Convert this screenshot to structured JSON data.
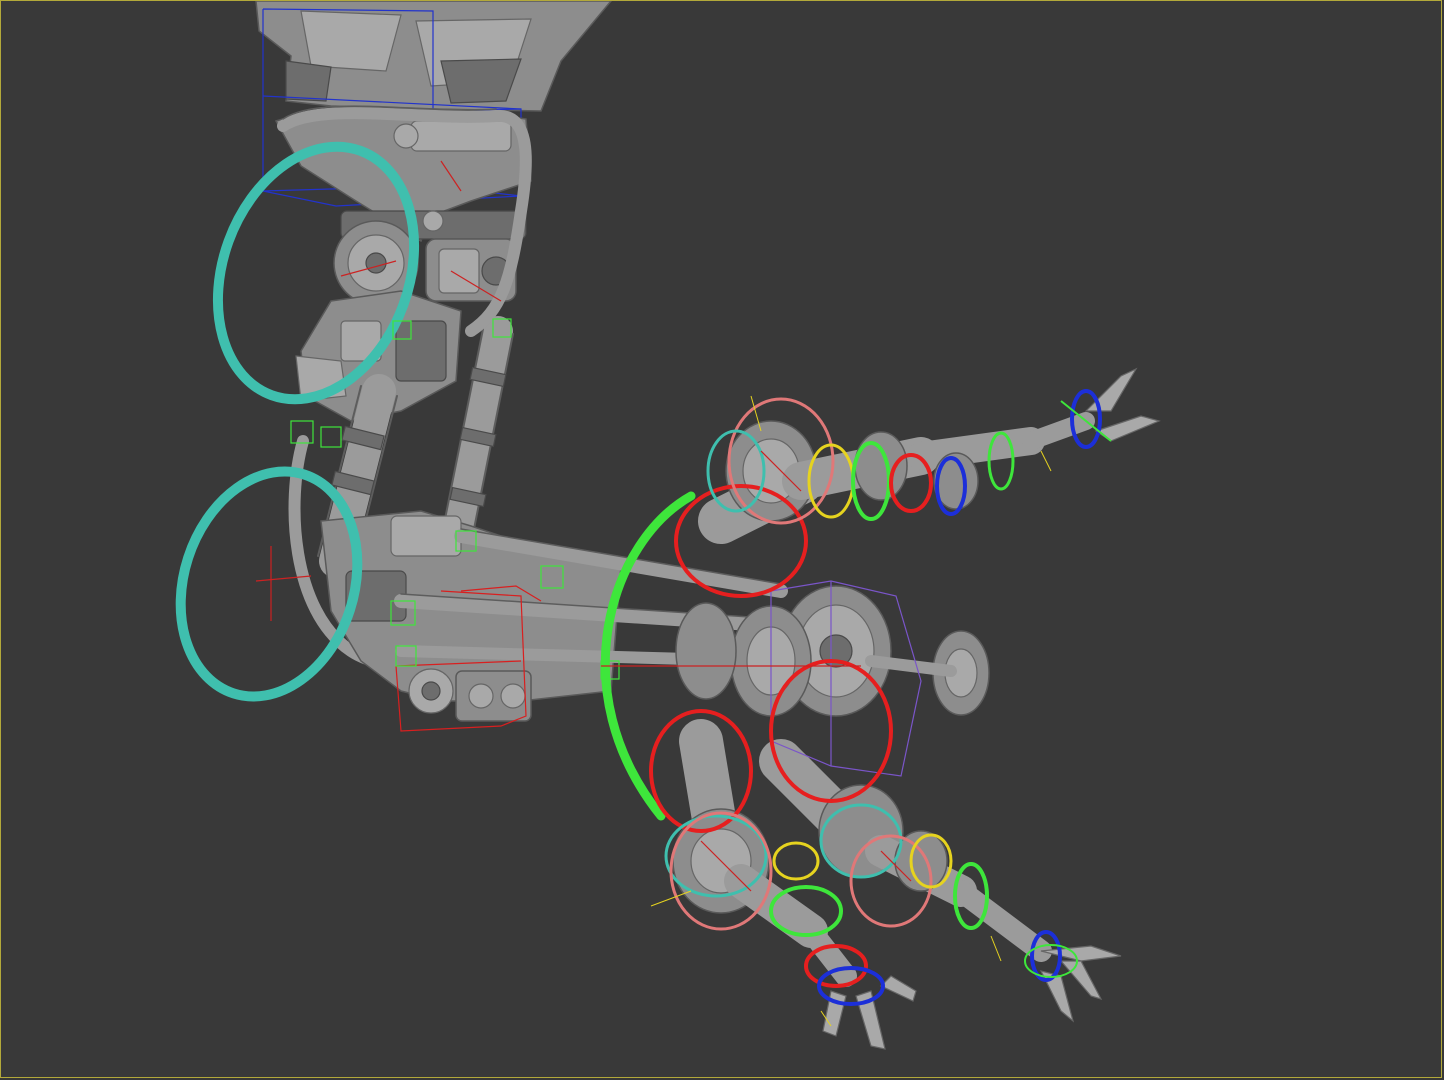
{
  "viewport": {
    "background": "#383838",
    "border_color": "#b3a93a",
    "view": "perspective"
  },
  "rig_colors": {
    "large_controller": "#3fbfae",
    "spread_controller": "#3ee63b",
    "finger_ring": "#e61f1f",
    "wrist_ring": "#f0f0f0",
    "accent_ring": "#e6d31f",
    "pivot_ring": "#1c2fd9",
    "helper_box_red": "#d91f1f",
    "helper_box_blue": "#2233cc",
    "helper_box_purple": "#7a55c9",
    "bone_axis": "#cc2222"
  },
  "model": {
    "name_icon": "mechanical-arm-model",
    "claws": 3
  }
}
